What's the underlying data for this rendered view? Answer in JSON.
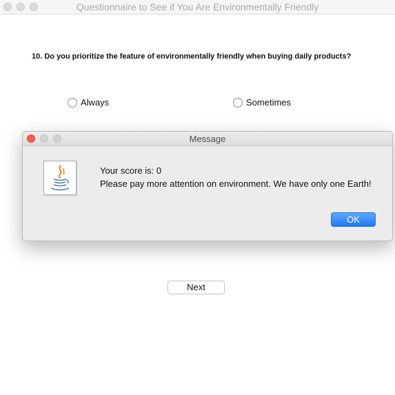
{
  "window": {
    "title": "Questionnaire to See if You Are Environmentally Friendly"
  },
  "question": {
    "text": "10. Do you prioritize the feature of environmentally friendly when buying daily products?",
    "options": [
      {
        "label": "Always",
        "selected": false
      },
      {
        "label": "Sometimes",
        "selected": false
      }
    ]
  },
  "next_button": {
    "label": "Next"
  },
  "dialog": {
    "title": "Message",
    "icon": "java-cup-icon",
    "line1": "Your score is: 0",
    "line2": "Please pay more attention on environment. We have only one Earth!",
    "ok_label": "OK"
  },
  "colors": {
    "accent_button": "#1f78f2",
    "close_light": "#fc5b57"
  }
}
